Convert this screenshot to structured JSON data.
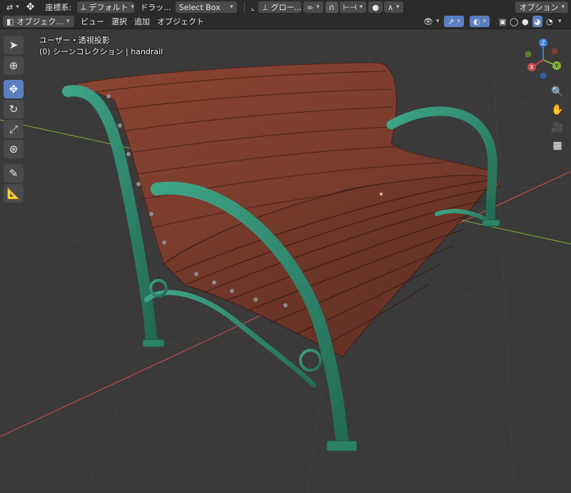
{
  "header": {
    "coord_label": "座標系:",
    "orientation_value": "デフォルト",
    "drag_label": "ドラッ...",
    "select_mode": "Select Box",
    "pivot_label": "グロー...",
    "options_label": "オプション"
  },
  "menu": {
    "mode_label": "オブジェク...",
    "items": [
      "ビュー",
      "選択",
      "追加",
      "オブジェクト"
    ]
  },
  "viewport": {
    "view_name": "ユーザー・透視投影",
    "collection_info": "(0) シーンコレクション | handrail"
  },
  "gizmo": {
    "x": "X",
    "y": "Y",
    "z": "Z"
  },
  "tools": [
    "select-box",
    "cursor",
    "move",
    "rotate",
    "scale",
    "transform",
    "annotate",
    "measure"
  ],
  "nav_icons": [
    "zoom-icon",
    "hand-pan-icon",
    "camera-icon",
    "grid-ortho-icon"
  ],
  "colors": {
    "accent": "#5a7fc0",
    "wood": "#7a3d2c",
    "iron": "#2f8a6c",
    "axis_x": "#c84a4a",
    "axis_y": "#82b53c",
    "axis_z": "#3f7fd8"
  }
}
